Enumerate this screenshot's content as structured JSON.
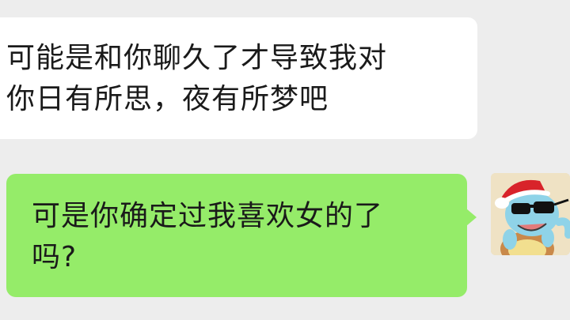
{
  "chat": {
    "messages": [
      {
        "direction": "received",
        "lines": [
          "可能是和你聊久了才导致我对",
          "你日有所思，夜有所梦吧"
        ]
      },
      {
        "direction": "sent",
        "lines": [
          "可是你确定过我喜欢女的了",
          "吗?"
        ]
      }
    ],
    "colors": {
      "background": "#ededed",
      "received_bubble": "#ffffff",
      "sent_bubble": "#95ec69",
      "text": "#1a1a1a"
    },
    "avatar": {
      "icon": "squirtle-with-santa-hat-and-sunglasses-avatar"
    }
  }
}
